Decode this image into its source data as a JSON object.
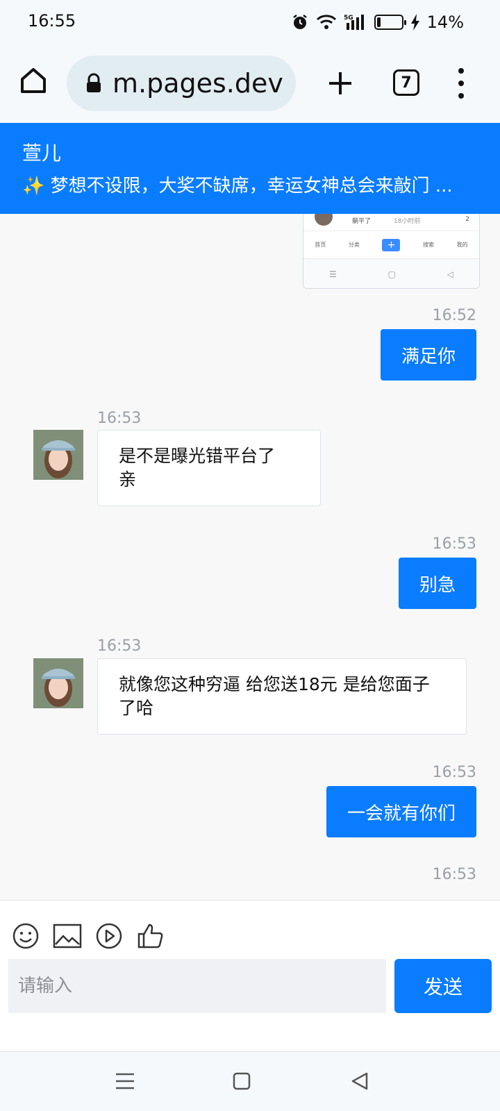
{
  "status_bar": {
    "time": "16:55",
    "battery_pct": "14%",
    "network": "5G"
  },
  "browser": {
    "url": "m.pages.dev",
    "tab_count": "7"
  },
  "header": {
    "name": "萱儿",
    "slogan": "✨ 梦想不设限，大奖不缺席，幸运女神总会来敲门 ..."
  },
  "shared_screenshot": {
    "user": "躺平了",
    "time": "18小时前",
    "count": "2",
    "nav": [
      "首页",
      "分类",
      "+",
      "搜索",
      "我的"
    ]
  },
  "messages": [
    {
      "side": "out",
      "time": "16:52",
      "text": "满足你"
    },
    {
      "side": "in",
      "time": "16:53",
      "text": "是不是曝光错平台了\n亲"
    },
    {
      "side": "out",
      "time": "16:53",
      "text": "别急"
    },
    {
      "side": "in",
      "time": "16:53",
      "text": "就像您这种穷逼 给您送18元 是给您面子\n了哈"
    },
    {
      "side": "out",
      "time": "16:53",
      "text": "一会就有你们"
    },
    {
      "side": "out",
      "time": "16:53",
      "text": ""
    }
  ],
  "composer": {
    "placeholder": "请输入",
    "send_label": "发送"
  },
  "colors": {
    "accent": "#0a7cff"
  }
}
